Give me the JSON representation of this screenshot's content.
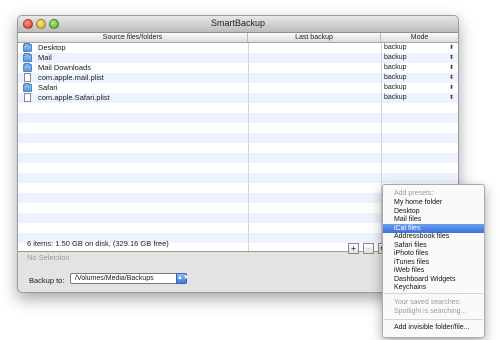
{
  "window": {
    "title": "SmartBackup"
  },
  "table": {
    "columns": [
      "Source files/folders",
      "Last backup",
      "Mode"
    ],
    "rows": [
      {
        "name": "Desktop",
        "type": "folder",
        "last_backup": "",
        "mode": "backup"
      },
      {
        "name": "Mail",
        "type": "folder",
        "last_backup": "",
        "mode": "backup"
      },
      {
        "name": "Mail Downloads",
        "type": "folder",
        "last_backup": "",
        "mode": "backup"
      },
      {
        "name": "com.apple.mail.plist",
        "type": "file",
        "last_backup": "",
        "mode": "backup"
      },
      {
        "name": "Safari",
        "type": "folder",
        "last_backup": "",
        "mode": "backup"
      },
      {
        "name": "com.apple.Safari.plist",
        "type": "file",
        "last_backup": "",
        "mode": "backup"
      }
    ]
  },
  "status": {
    "summary": "6 items: 1.50 GB on disk, (329.16 GB free)",
    "selection": "No Selection"
  },
  "buttons": {
    "add": "+",
    "remove": "-",
    "gear": "⚙"
  },
  "destination": {
    "label": "Backup to:",
    "path": "/Volumes/Media/Backups"
  },
  "menu": {
    "presets_header": "Add presets:",
    "presets": [
      "My home folder",
      "Desktop",
      "Mail files",
      "iCal files",
      "Addressbook files",
      "Safari files",
      "iPhoto files",
      "iTunes files",
      "iWeb files",
      "Dashboard Widgets",
      "Keychains"
    ],
    "selected": "iCal files",
    "searches_header": "Your saved searches:",
    "searches_status": "Spotlight is searching...",
    "add_invisible": "Add invisible folder/file..."
  },
  "icons": {
    "folder": "folder-icon",
    "file": "document-icon",
    "popup": "popup-arrows-icon"
  }
}
